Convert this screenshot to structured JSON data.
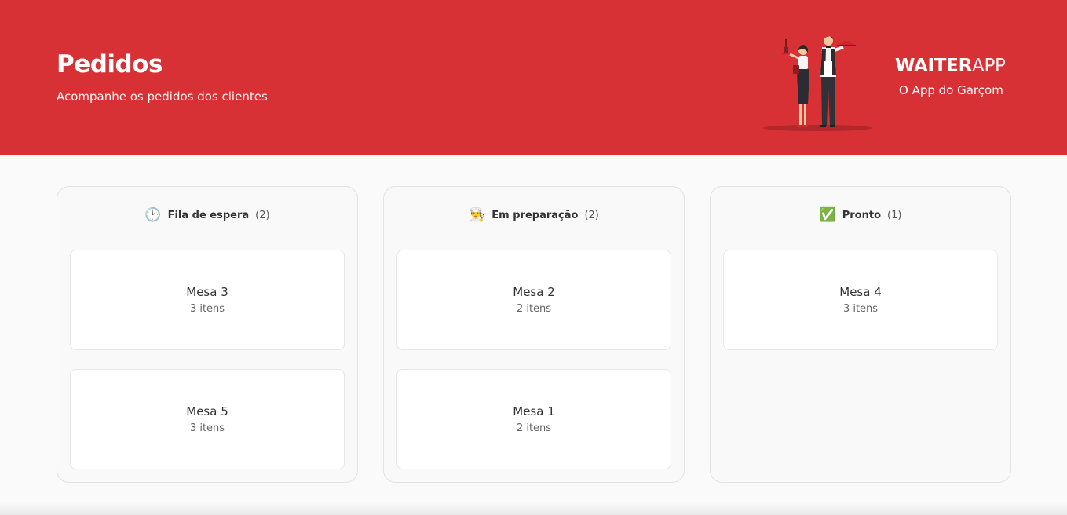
{
  "header": {
    "title": "Pedidos",
    "subtitle": "Acompanhe os pedidos dos clientes",
    "brand_strong": "WAITER",
    "brand_light": "APP",
    "tagline": "O App do Garçom",
    "accent_color": "#d73035"
  },
  "columns": [
    {
      "icon": "🕑",
      "icon_name": "clock-icon",
      "title": "Fila de espera",
      "count": "(2)",
      "orders": [
        {
          "table": "Mesa 3",
          "items": "3 itens"
        },
        {
          "table": "Mesa 5",
          "items": "3 itens"
        }
      ]
    },
    {
      "icon": "👨‍🍳",
      "icon_name": "chef-icon",
      "title": "Em preparação",
      "count": "(2)",
      "orders": [
        {
          "table": "Mesa 2",
          "items": "2 itens"
        },
        {
          "table": "Mesa 1",
          "items": "2 itens"
        }
      ]
    },
    {
      "icon": "✅",
      "icon_name": "check-mark-icon",
      "title": "Pronto",
      "count": "(1)",
      "orders": [
        {
          "table": "Mesa 4",
          "items": "3 itens"
        }
      ]
    }
  ]
}
